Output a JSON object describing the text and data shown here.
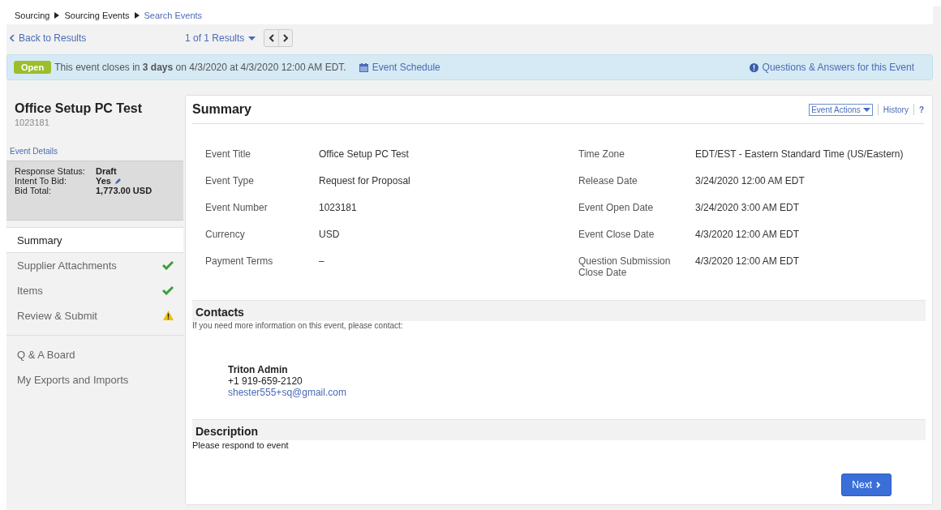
{
  "breadcrumbs": [
    {
      "label": "Sourcing",
      "current": false
    },
    {
      "label": "Sourcing Events",
      "current": false
    },
    {
      "label": "Search Events",
      "current": true
    }
  ],
  "nav": {
    "back": "Back to Results",
    "results": "1 of 1 Results"
  },
  "banner": {
    "badge": "Open",
    "message": "This event closes in **3 days** on 4/3/2020 at 4/3/2020 12:00 AM EDT.",
    "schedule_link": "Event Schedule",
    "qa_link": "Questions & Answers for this Event"
  },
  "sidebar": {
    "title": "Office Setup PC Test",
    "number": "1023181",
    "details_link": "Event Details",
    "status": [
      {
        "label": "Response Status:",
        "value": "Draft",
        "editable": false
      },
      {
        "label": "Intent To Bid:",
        "value": "Yes",
        "editable": true
      },
      {
        "label": "Bid Total:",
        "value": "1,773.00 USD",
        "editable": false
      }
    ],
    "steps": [
      {
        "label": "Summary",
        "selected": true,
        "kind": "plain"
      },
      {
        "label": "Supplier Attachments",
        "selected": false,
        "kind": "complete"
      },
      {
        "label": "Items",
        "selected": false,
        "kind": "complete"
      },
      {
        "label": "Review & Submit",
        "selected": false,
        "kind": "warning"
      }
    ],
    "links": [
      "Q & A Board",
      "My Exports and Imports"
    ]
  },
  "summary": {
    "title": "Summary",
    "actions": "Event Actions",
    "history": "History",
    "help": "?",
    "left_fields": [
      {
        "label": "Event Title",
        "value": "Office Setup PC Test"
      },
      {
        "label": "Event Type",
        "value": "Request for Proposal"
      },
      {
        "label": "Event Number",
        "value": "1023181"
      },
      {
        "label": "Currency",
        "value": "USD"
      },
      {
        "label": "Payment Terms",
        "value": "–"
      }
    ],
    "right_fields": [
      {
        "label": "Time Zone",
        "value": "EDT/EST - Eastern Standard Time (US/Eastern)"
      },
      {
        "label": "Release Date",
        "value": "3/24/2020 12:00 AM EDT"
      },
      {
        "label": "Event Open Date",
        "value": "3/24/2020 3:00 AM EDT"
      },
      {
        "label": "Event Close Date",
        "value": "4/3/2020 12:00 AM EDT"
      },
      {
        "label": "Question Submission Close Date",
        "value": "4/3/2020 12:00 AM EDT"
      }
    ]
  },
  "contacts": {
    "title": "Contacts",
    "intro": "If you need more information on this event, please contact:",
    "name": "Triton Admin",
    "phone": "+1 919-659-2120",
    "email": "shester555+sq@gmail.com"
  },
  "description": {
    "title": "Description",
    "text": "Please respond to event"
  },
  "next_button": "Next"
}
